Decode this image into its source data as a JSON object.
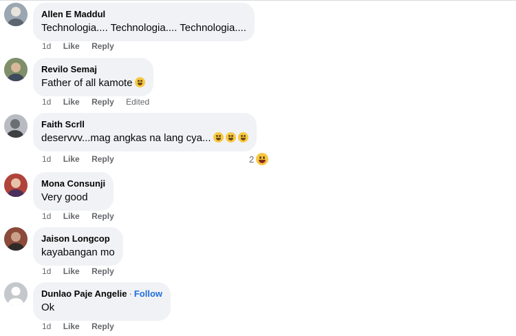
{
  "comments": [
    {
      "author": "Allen E Maddul",
      "text": "Technologia.... Technologia.... Technologia....",
      "time": "1d",
      "like": "Like",
      "reply": "Reply",
      "avatar_color": "#9aa6b2",
      "avatar_icon": "person-avatar"
    },
    {
      "author": "Revilo Semaj",
      "text": "Father of all kamote",
      "emoji": "rolling-laughing-emoji",
      "time": "1d",
      "like": "Like",
      "reply": "Reply",
      "edited": "Edited",
      "avatar_color": "#7f8f6a",
      "avatar_icon": "person-avatar"
    },
    {
      "author": "Faith Scrll",
      "text": "deservvv...mag angkas na lang cya...",
      "emoji": "grinning-emoji",
      "time": "1d",
      "like": "Like",
      "reply": "Reply",
      "reaction_count": "2",
      "reaction_icon": "haha-reaction-icon",
      "avatar_color": "#6b6e73",
      "avatar_icon": "person-avatar"
    },
    {
      "author": "Mona Consunji",
      "text": "Very good",
      "time": "1d",
      "like": "Like",
      "reply": "Reply",
      "avatar_color": "#b0433a",
      "avatar_icon": "person-avatar"
    },
    {
      "author": "Jaison Longcop",
      "text": "kayabangan mo",
      "time": "1d",
      "like": "Like",
      "reply": "Reply",
      "avatar_color": "#8c4a3a",
      "avatar_icon": "person-avatar"
    },
    {
      "author": "Dunlao Paje Angelie",
      "follow": "Follow",
      "text": "Ok",
      "time": "1d",
      "like": "Like",
      "reply": "Reply",
      "avatar_color": "#c4c7cc",
      "avatar_icon": "default-avatar"
    }
  ]
}
